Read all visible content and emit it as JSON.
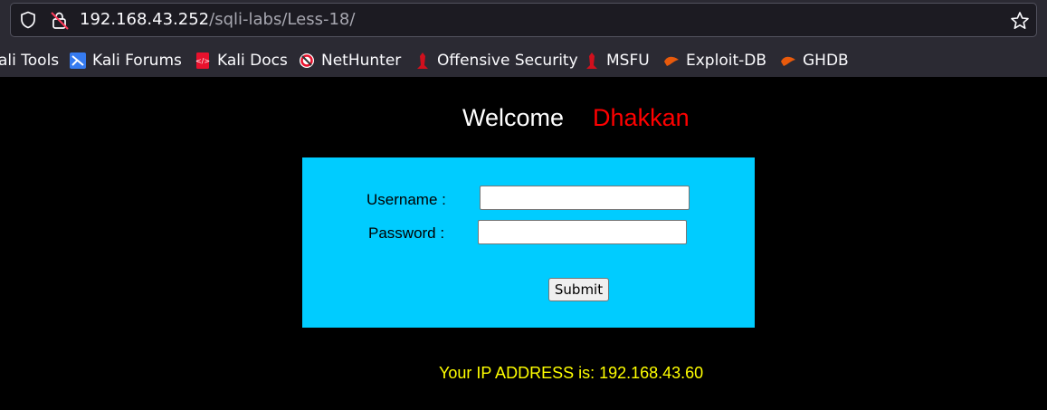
{
  "browser": {
    "url_host": "192.168.43.252",
    "url_path": "/sqli-labs/Less-18/",
    "bookmarks": [
      {
        "label": "ali Tools",
        "icon": "kali-tools-icon"
      },
      {
        "label": "Kali Forums",
        "icon": "kali-forums-icon"
      },
      {
        "label": "Kali Docs",
        "icon": "kali-docs-icon"
      },
      {
        "label": "NetHunter",
        "icon": "nethunter-icon"
      },
      {
        "label": "Offensive Security",
        "icon": "offensive-security-icon"
      },
      {
        "label": "MSFU",
        "icon": "msfu-icon"
      },
      {
        "label": "Exploit-DB",
        "icon": "exploit-db-icon"
      },
      {
        "label": "GHDB",
        "icon": "ghdb-icon"
      }
    ]
  },
  "page": {
    "welcome": "Welcome",
    "name": "Dhakkan",
    "form": {
      "username_label": "Username :",
      "password_label": "Password :",
      "username_value": "",
      "password_value": "",
      "submit_label": "Submit"
    },
    "ip_text": "Your IP ADDRESS is: 192.168.43.60"
  },
  "colors": {
    "panel": "#00ccff",
    "name": "#ff0000",
    "ip_text": "#ffff00",
    "background": "#000000"
  }
}
